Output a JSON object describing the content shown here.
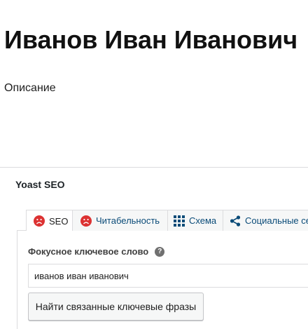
{
  "post": {
    "title": "Иванов Иван Иванович",
    "description": "Описание"
  },
  "metabox": {
    "title": "Yoast SEO",
    "tabs": [
      {
        "label": "SEO",
        "icon": "sad-face-icon",
        "active": true
      },
      {
        "label": "Читабельность",
        "icon": "sad-face-icon",
        "active": false
      },
      {
        "label": "Схема",
        "icon": "grid-icon",
        "active": false
      },
      {
        "label": "Социальные се",
        "icon": "share-icon",
        "active": false
      }
    ],
    "focus_keyword": {
      "label": "Фокусное ключевое слово",
      "help": "?",
      "value": "иванов иван иванович"
    },
    "related_button": "Найти связанные ключевые фразы"
  },
  "colors": {
    "bad_score": "#dc3232",
    "icon_blue": "#0a4b78",
    "border": "#dcdcde"
  }
}
